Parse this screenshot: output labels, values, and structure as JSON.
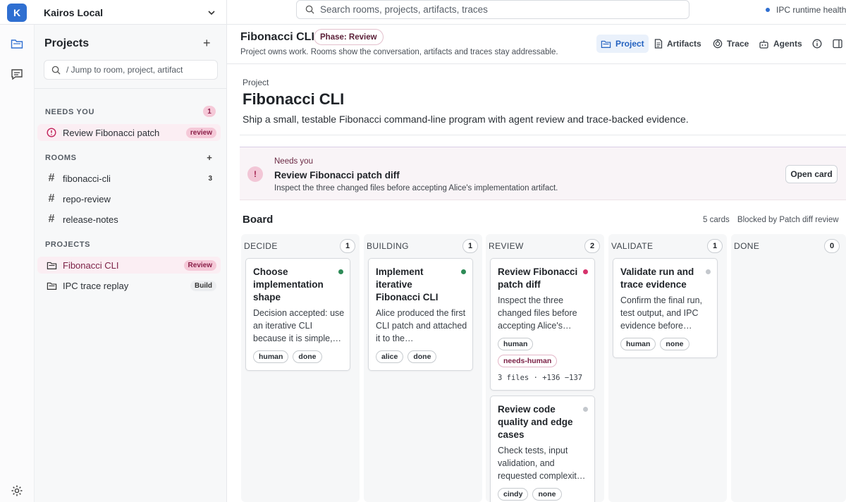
{
  "workspace": {
    "initial": "K",
    "name": "Kairos Local"
  },
  "search": {
    "placeholder": "Search rooms, projects, artifacts, traces"
  },
  "runtime_status": "IPC runtime healthy",
  "sidebar": {
    "title": "Projects",
    "add": "+",
    "jump_placeholder": "/ Jump to room, project, artifact",
    "needs_you": {
      "label": "NEEDS YOU",
      "count": "1",
      "items": [
        {
          "label": "Review Fibonacci patch",
          "tag": "review"
        }
      ]
    },
    "rooms": {
      "label": "ROOMS",
      "add": "+",
      "items": [
        {
          "label": "fibonacci-cli",
          "count": "3"
        },
        {
          "label": "repo-review",
          "count": ""
        },
        {
          "label": "release-notes",
          "count": ""
        }
      ]
    },
    "projects": {
      "label": "PROJECTS",
      "items": [
        {
          "label": "Fibonacci CLI",
          "tag": "Review"
        },
        {
          "label": "IPC trace replay",
          "tag": "Build"
        }
      ]
    }
  },
  "header": {
    "title": "Fibonacci CLI",
    "phase": "Phase: Review",
    "subtitle": "Project owns work. Rooms show the conversation, artifacts and traces stay addressable.",
    "tabs": [
      {
        "label": "Project",
        "icon": "folder-icon",
        "active": true
      },
      {
        "label": "Artifacts",
        "icon": "document-icon"
      },
      {
        "label": "Trace",
        "icon": "trace-icon"
      },
      {
        "label": "Agents",
        "icon": "agents-icon"
      }
    ]
  },
  "project": {
    "eyebrow": "Project",
    "title": "Fibonacci CLI",
    "description": "Ship a small, testable Fibonacci command-line program with agent review and trace-backed evidence."
  },
  "alert": {
    "icon": "!",
    "kicker": "Needs you",
    "title": "Review Fibonacci patch diff",
    "detail": "Inspect the three changed files before accepting Alice's implementation artifact.",
    "button": "Open card"
  },
  "board": {
    "title": "Board",
    "cards_count": "5 cards",
    "blocked": "Blocked by Patch diff review",
    "columns": [
      {
        "name": "DECIDE",
        "count": "1",
        "cards": [
          {
            "title": "Choose implementation shape",
            "status_color": "#2e8b57",
            "desc": "Decision accepted: use an iterative CLI because it is simple,…",
            "chips": [
              "human",
              "done"
            ]
          }
        ]
      },
      {
        "name": "BUILDING",
        "count": "1",
        "cards": [
          {
            "title": "Implement iterative Fibonacci CLI",
            "status_color": "#2e8b57",
            "desc": "Alice produced the first CLI patch and attached it to the…",
            "chips": [
              "alice",
              "done"
            ]
          }
        ]
      },
      {
        "name": "REVIEW",
        "count": "2",
        "cards": [
          {
            "title": "Review Fibonacci patch diff",
            "status_color": "#d6336c",
            "desc": "Inspect the three changed files before accepting Alice's…",
            "chips": [
              "human",
              "needs-human"
            ],
            "meta": "3 files · +136 −137"
          },
          {
            "title": "Review code quality and edge cases",
            "status_color": "#c4c8cd",
            "desc": "Check tests, input validation, and requested complexit…",
            "chips": [
              "cindy",
              "none"
            ]
          }
        ]
      },
      {
        "name": "VALIDATE",
        "count": "1",
        "cards": [
          {
            "title": "Validate run and trace evidence",
            "status_color": "#c4c8cd",
            "desc": "Confirm the final run, test output, and IPC evidence before…",
            "chips": [
              "human",
              "none"
            ]
          }
        ]
      },
      {
        "name": "DONE",
        "count": "0",
        "cards": []
      }
    ]
  }
}
